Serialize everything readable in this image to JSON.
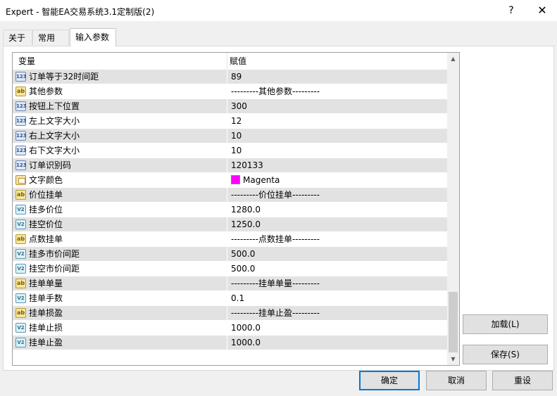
{
  "window": {
    "title": "Expert - 智能EA交易系统3.1定制版(2)",
    "help_glyph": "?",
    "close_glyph": "✕"
  },
  "tabs": [
    {
      "label": "关于",
      "active": false
    },
    {
      "label": "常用",
      "active": false
    },
    {
      "label": "输入参数",
      "active": true
    }
  ],
  "grid": {
    "col_variable": "变量",
    "col_value": "赋值",
    "rows": [
      {
        "icon": "int-icon",
        "badge": "123",
        "name": "订单等于32时间距",
        "value": "89"
      },
      {
        "icon": "string-icon",
        "badge": "ab",
        "name": "其他参数",
        "value": "---------其他参数---------"
      },
      {
        "icon": "int-icon",
        "badge": "123",
        "name": "按钮上下位置",
        "value": "300"
      },
      {
        "icon": "int-icon",
        "badge": "123",
        "name": "左上文字大小",
        "value": "12"
      },
      {
        "icon": "int-icon",
        "badge": "123",
        "name": "右上文字大小",
        "value": "10"
      },
      {
        "icon": "int-icon",
        "badge": "123",
        "name": "右下文字大小",
        "value": "10"
      },
      {
        "icon": "int-icon",
        "badge": "123",
        "name": "订单识别码",
        "value": "120133"
      },
      {
        "icon": "color-icon",
        "badge": "",
        "name": "文字颜色",
        "value": "Magenta",
        "swatch": "#ff00ff"
      },
      {
        "icon": "string-icon",
        "badge": "ab",
        "name": "价位挂单",
        "value": "---------价位挂单---------"
      },
      {
        "icon": "double-icon",
        "badge": "V2",
        "name": "挂多价位",
        "value": "1280.0"
      },
      {
        "icon": "double-icon",
        "badge": "V2",
        "name": "挂空价位",
        "value": "1250.0"
      },
      {
        "icon": "string-icon",
        "badge": "ab",
        "name": "点数挂单",
        "value": "---------点数挂单---------"
      },
      {
        "icon": "double-icon",
        "badge": "V2",
        "name": "挂多市价间距",
        "value": "500.0"
      },
      {
        "icon": "double-icon",
        "badge": "V2",
        "name": "挂空市价间距",
        "value": "500.0"
      },
      {
        "icon": "string-icon",
        "badge": "ab",
        "name": "挂单单量",
        "value": "---------挂单单量---------"
      },
      {
        "icon": "double-icon",
        "badge": "V2",
        "name": "挂单手数",
        "value": "0.1"
      },
      {
        "icon": "string-icon",
        "badge": "ab",
        "name": "挂单损盈",
        "value": "---------挂单止盈---------"
      },
      {
        "icon": "double-icon",
        "badge": "V2",
        "name": "挂单止损",
        "value": "1000.0"
      },
      {
        "icon": "double-icon",
        "badge": "V2",
        "name": "挂单止盈",
        "value": "1000.0"
      }
    ]
  },
  "scrollbar": {
    "up_glyph": "▲",
    "down_glyph": "▼"
  },
  "buttons": {
    "load": "加载(L)",
    "save": "保存(S)",
    "ok": "确定",
    "cancel": "取消",
    "reset": "重设"
  },
  "colors": {
    "accent": "#0078d7",
    "row_shade": "#e2e2e2",
    "magenta": "#ff00ff"
  }
}
